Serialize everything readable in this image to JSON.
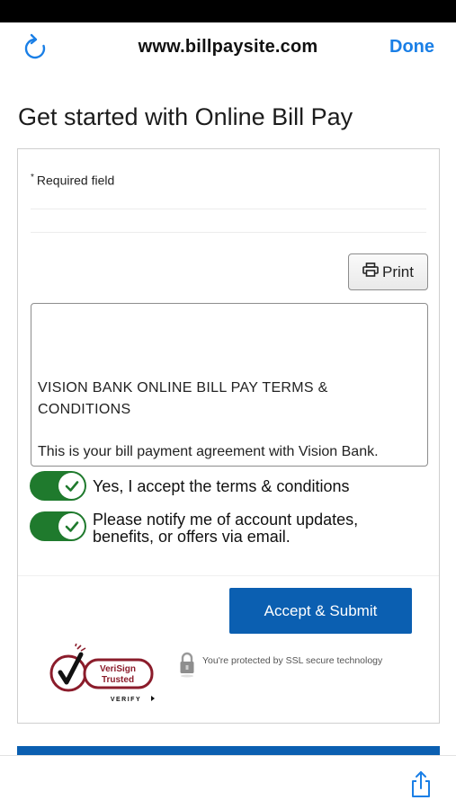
{
  "browser": {
    "url": "www.billpaysite.com",
    "done_label": "Done",
    "reload_icon": "reload-icon",
    "share_icon": "share-icon",
    "accent_color": "#1a7fe6"
  },
  "page": {
    "title": "Get started with Online Bill Pay"
  },
  "form": {
    "required_marker": "*",
    "required_label": "Required field",
    "print_label": "Print",
    "terms_heading": "VISION BANK ONLINE BILL PAY TERMS & CONDITIONS",
    "terms_text": "This is your bill payment agreement with Vision Bank.",
    "toggles": [
      {
        "label": "Yes, I accept the terms & conditions",
        "on": true
      },
      {
        "label": "Please notify me of account updates, benefits, or offers via email.",
        "on": true
      }
    ],
    "submit_label": "Accept & Submit",
    "toggle_color": "#1f7a2d",
    "submit_color": "#0b5fb1"
  },
  "security": {
    "verisign_line1": "VeriSign",
    "verisign_line2": "Trusted",
    "verisign_verify": "VERIFY",
    "ssl_text": "You're protected by SSL secure technology"
  }
}
